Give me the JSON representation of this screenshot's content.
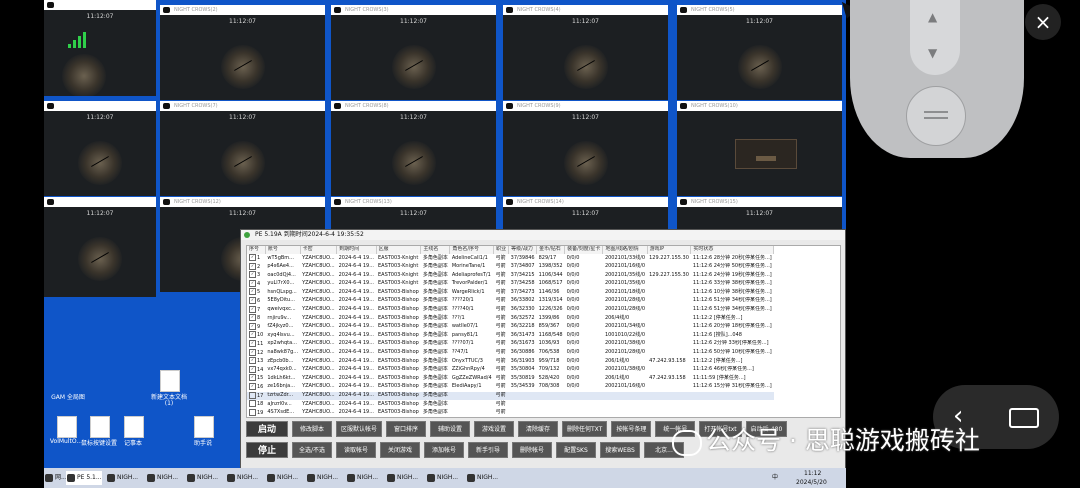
{
  "tiles": [
    {
      "title": "",
      "clock": "11:12:07"
    },
    {
      "title": "NIGHT CROWS(2)",
      "clock": "11:12:07"
    },
    {
      "title": "NIGHT CROWS(3)",
      "clock": "11:12:07"
    },
    {
      "title": "NIGHT CROWS(4)",
      "clock": "11:12:07"
    },
    {
      "title": "NIGHT CROWS(5)",
      "clock": "11:12:07"
    },
    {
      "title": "",
      "clock": "11:12:07"
    },
    {
      "title": "NIGHT CROWS(7)",
      "clock": "11:12:07"
    },
    {
      "title": "NIGHT CROWS(8)",
      "clock": "11:12:07"
    },
    {
      "title": "NIGHT CROWS(9)",
      "clock": "11:12:07"
    },
    {
      "title": "NIGHT CROWS(10)",
      "clock": ""
    },
    {
      "title": "",
      "clock": "11:12:07"
    },
    {
      "title": "NIGHT CROWS(12)",
      "clock": "11:12:07"
    },
    {
      "title": "NIGHT CROWS(13)",
      "clock": "11:12:07"
    },
    {
      "title": "NIGHT CROWS(14)",
      "clock": "11:12:07"
    },
    {
      "title": "NIGHT CROWS(15)",
      "clock": "11:12:07"
    }
  ],
  "desktop": {
    "icons": [
      "GAM 全局图",
      "新建文本文档",
      "VolMultO...",
      "鼠标按键设置",
      "记事本",
      "助手说"
    ],
    "icon_small": "(1)"
  },
  "app": {
    "title": "PE 5.19A 到期时间2024-6-4 19:35:52",
    "columns": [
      "序号",
      "账号",
      "卡密",
      "到期时间",
      "区服",
      "主线名",
      "角色名/序号",
      "职业",
      "等级/战力",
      "金币/钻石",
      "装备/刻度/星卡",
      "地图/线路/剧情",
      "游戏IP",
      "实时状态"
    ],
    "rows": [
      {
        "n": "1",
        "chk": true,
        "acct": "wT5gBm...",
        "card": "YZAHC8UO...",
        "exp": "2024-6-4 19...",
        "srv": "EAST003-Knight",
        "main": "多角色副本",
        "role": "AdelineCall1/1",
        "job": "弓箭",
        "lvl": "37/39846",
        "gold": "829/17",
        "equip": "0/0/0",
        "map": "2002101/33线/0",
        "ip": "129.227.155.30",
        "status": "11:12:6 28分钟 20秒[停某任务...]"
      },
      {
        "n": "2",
        "chk": true,
        "acct": "p4s6Ae4...",
        "card": "YZAHC8UO...",
        "exp": "2024-6-4 19...",
        "srv": "EAST003-Knight",
        "main": "多角色副本",
        "role": "MorineTane/1",
        "job": "弓箭",
        "lvl": "37/34807",
        "gold": "1398/352",
        "equip": "0/0/0",
        "map": "2002101/16线/0",
        "ip": "",
        "status": "11:12:6 24分钟 50秒[停某任务...]"
      },
      {
        "n": "3",
        "chk": true,
        "acct": "oac0dQj4...",
        "card": "YZAHC8UO...",
        "exp": "2024-6-4 19...",
        "srv": "EAST003-Knight",
        "main": "多角色副本",
        "role": "AdeliaprofesT/1",
        "job": "弓箭",
        "lvl": "37/34215",
        "gold": "1106/344",
        "equip": "0/0/0",
        "map": "2002101/35线/0",
        "ip": "129.227.155.30",
        "status": "11:12:6 24分钟 19秒[停某任务...]"
      },
      {
        "n": "4",
        "chk": true,
        "acct": "yuLl7rX0...",
        "card": "YZAHC8UO...",
        "exp": "2024-6-4 19...",
        "srv": "EAST003-Knight",
        "main": "多角色副本",
        "role": "TrevorPalder/1",
        "job": "弓箭",
        "lvl": "37/34258",
        "gold": "1068/517",
        "equip": "0/0/0",
        "map": "2002101/35线/0",
        "ip": "",
        "status": "11:12:6 33分钟 38秒[停某任务...]"
      },
      {
        "n": "5",
        "chk": true,
        "acct": "hsnQLspg...",
        "card": "YZAHC8UO...",
        "exp": "2024-6-4 19...",
        "srv": "EAST003-Bishop",
        "main": "多角色副本",
        "role": "WargeRlick/1",
        "job": "弓箭",
        "lvl": "37/34273",
        "gold": "1146/36",
        "equip": "0/0/0",
        "map": "2002101/18线/0",
        "ip": "",
        "status": "11:12:6 10分钟 38秒[停某任务...]"
      },
      {
        "n": "6",
        "chk": true,
        "acct": "5E8yDitu...",
        "card": "YZAHC8UO...",
        "exp": "2024-6-4 19...",
        "srv": "EAST003-Bishop",
        "main": "多角色副本",
        "role": "????20/1",
        "job": "弓箭",
        "lvl": "36/33802",
        "gold": "1319/314",
        "equip": "0/0/0",
        "map": "2002101/28线/0",
        "ip": "",
        "status": "11:12:6 51分钟 34秒[停某任务...]"
      },
      {
        "n": "7",
        "chk": true,
        "acct": "qweivqxc...",
        "card": "YZAHC8UO...",
        "exp": "2024-6-4 19...",
        "srv": "EAST003-Bishop",
        "main": "多角色副本",
        "role": "????40/1",
        "job": "弓箭",
        "lvl": "36/32330",
        "gold": "1226/326",
        "equip": "0/0/0",
        "map": "2002101/28线/0",
        "ip": "",
        "status": "11:12:6 51分钟 34秒[停某任务...]"
      },
      {
        "n": "8",
        "chk": true,
        "acct": "rnjiru9v...",
        "card": "YZAHC8UO...",
        "exp": "2024-6-4 19...",
        "srv": "EAST003-Bishop",
        "main": "多角色副本",
        "role": "???/1",
        "job": "弓箭",
        "lvl": "36/32572",
        "gold": "1399/86",
        "equip": "0/0/0",
        "map": "206/4线/0",
        "ip": "",
        "status": "11:12:2 [停某任务...]"
      },
      {
        "n": "9",
        "chk": true,
        "acct": "fZ4jkyz0...",
        "card": "YZAHC8UO...",
        "exp": "2024-6-4 19...",
        "srv": "EAST003-Bishop",
        "main": "多角色副本",
        "role": "watlle07/1",
        "job": "弓箭",
        "lvl": "36/32218",
        "gold": "859/367",
        "equip": "0/0/0",
        "map": "2002101/34线/0",
        "ip": "",
        "status": "11:12:6 20分钟 18秒[停某任务...]"
      },
      {
        "n": "10",
        "chk": true,
        "acct": "xyq4lsvu...",
        "card": "YZAHC8UO...",
        "exp": "2024-6-4 19...",
        "srv": "EAST003-Bishop",
        "main": "多角色副本",
        "role": "pansy81/1",
        "job": "弓箭",
        "lvl": "36/31473",
        "gold": "1168/548",
        "equip": "0/0/0",
        "map": "1001010/22线/0",
        "ip": "",
        "status": "11:12:6 [搜队]...048"
      },
      {
        "n": "11",
        "chk": true,
        "acct": "xp2whqta...",
        "card": "YZAHC8UO...",
        "exp": "2024-6-4 19...",
        "srv": "EAST003-Bishop",
        "main": "多角色副本",
        "role": "????07/1",
        "job": "弓箭",
        "lvl": "36/31673",
        "gold": "1036/93",
        "equip": "0/0/0",
        "map": "2002101/38线/0",
        "ip": "",
        "status": "11:12:6 2分钟 33秒[停某任务...]"
      },
      {
        "n": "12",
        "chk": true,
        "acct": "na8wk87g...",
        "card": "YZAHC8UO...",
        "exp": "2024-6-4 19...",
        "srv": "EAST003-Bishop",
        "main": "多角色副本",
        "role": "??47/1",
        "job": "弓箭",
        "lvl": "36/30886",
        "gold": "706/538",
        "equip": "0/0/0",
        "map": "2002101/28线/0",
        "ip": "",
        "status": "11:12:6 50分钟 10秒[停某任务...]"
      },
      {
        "n": "13",
        "chk": true,
        "acct": "zEpcb0b...",
        "card": "YZAHC8UO...",
        "exp": "2024-6-4 19...",
        "srv": "EAST003-Bishop",
        "main": "多角色副本",
        "role": "OnyxTTUC/3",
        "job": "弓箭",
        "lvl": "36/31903",
        "gold": "959/718",
        "equip": "0/0/0",
        "map": "206/1线/0",
        "ip": "47.242.93.158",
        "status": "11:12:2 [停某任务...]"
      },
      {
        "n": "14",
        "chk": true,
        "acct": "vx74qxk0...",
        "card": "YZAHC8UO...",
        "exp": "2024-6-4 19...",
        "srv": "EAST003-Bishop",
        "main": "多角色副本",
        "role": "ZZiGhnRpy/4",
        "job": "弓箭",
        "lvl": "35/30804",
        "gold": "709/132",
        "equip": "0/0/0",
        "map": "2002101/38线/0",
        "ip": "",
        "status": "11:12:6 46秒[停某任务...]"
      },
      {
        "n": "15",
        "chk": true,
        "acct": "1dkLh6kt...",
        "card": "YZAHC8UO...",
        "exp": "2024-6-4 19...",
        "srv": "EAST003-Bishop",
        "main": "多角色副本",
        "role": "GgZZeZWRad/4",
        "job": "弓箭",
        "lvl": "35/30819",
        "gold": "528/420",
        "equip": "0/0/0",
        "map": "206/1线/0",
        "ip": "47.242.93.158",
        "status": "11:11:59 [停某任务...]"
      },
      {
        "n": "16",
        "chk": true,
        "acct": "ze16bnja...",
        "card": "YZAHC8UO...",
        "exp": "2024-6-4 19...",
        "srv": "EAST003-Bishop",
        "main": "多角色副本",
        "role": "ElediAapy/1",
        "job": "弓箭",
        "lvl": "35/34539",
        "gold": "708/308",
        "equip": "0/0/0",
        "map": "2002101/16线/0",
        "ip": "",
        "status": "11:12:6 15分钟 31秒[停某任务...]"
      },
      {
        "n": "17",
        "chk": false,
        "acct": "tzrtwZdr...",
        "card": "YZAHC8UO...",
        "exp": "2024-6-4 19...",
        "srv": "EAST003-Bishop",
        "main": "多角色副本",
        "role": "",
        "job": "弓箭",
        "lvl": "",
        "gold": "",
        "equip": "",
        "map": "",
        "ip": "",
        "status": ""
      },
      {
        "n": "18",
        "chk": false,
        "acct": "aJnzrl0v...",
        "card": "YZAHC8UO...",
        "exp": "2024-6-4 19...",
        "srv": "EAST003-Bishop",
        "main": "多角色副本",
        "role": "",
        "job": "弓箭",
        "lvl": "",
        "gold": "",
        "equip": "",
        "map": "",
        "ip": "",
        "status": ""
      },
      {
        "n": "19",
        "chk": false,
        "acct": "4S7XsdE...",
        "card": "YZAHC8UO...",
        "exp": "2024-6-4 19...",
        "srv": "EAST003-Bishop",
        "main": "多角色副本",
        "role": "",
        "job": "弓箭",
        "lvl": "",
        "gold": "",
        "equip": "",
        "map": "",
        "ip": "",
        "status": ""
      }
    ],
    "buttons_row1": [
      "启动",
      "修改脚本",
      "区服默认帐号",
      "窗口排序",
      "辅助设置",
      "游戏设置",
      "清除缓存",
      "删除任何TXT",
      "按帐号条理",
      "统一帐号",
      "打开帐号txt",
      "启动后-480"
    ],
    "buttons_row2": [
      "停止",
      "全选/不选",
      "读取帐号",
      "关闭游戏",
      "添加帐号",
      "新手引导",
      "删除帐号",
      "配置SKS",
      "搜索WEBS",
      "北京..."
    ]
  },
  "taskbar": {
    "items": [
      "PE 5.1...",
      "NIGH...",
      "NIGH...",
      "NIGH...",
      "NIGH...",
      "NIGH...",
      "NIGH...",
      "NIGH...",
      "NIGH...",
      "NIGH...",
      "NIGH..."
    ],
    "start_label": "网...",
    "time": "11:12",
    "date": "2024/5/20",
    "ime": "中"
  },
  "overlay": {
    "watermark": "公众号 · 思聪游戏搬砖社",
    "close_glyph": "×",
    "back_glyph": "‹"
  }
}
